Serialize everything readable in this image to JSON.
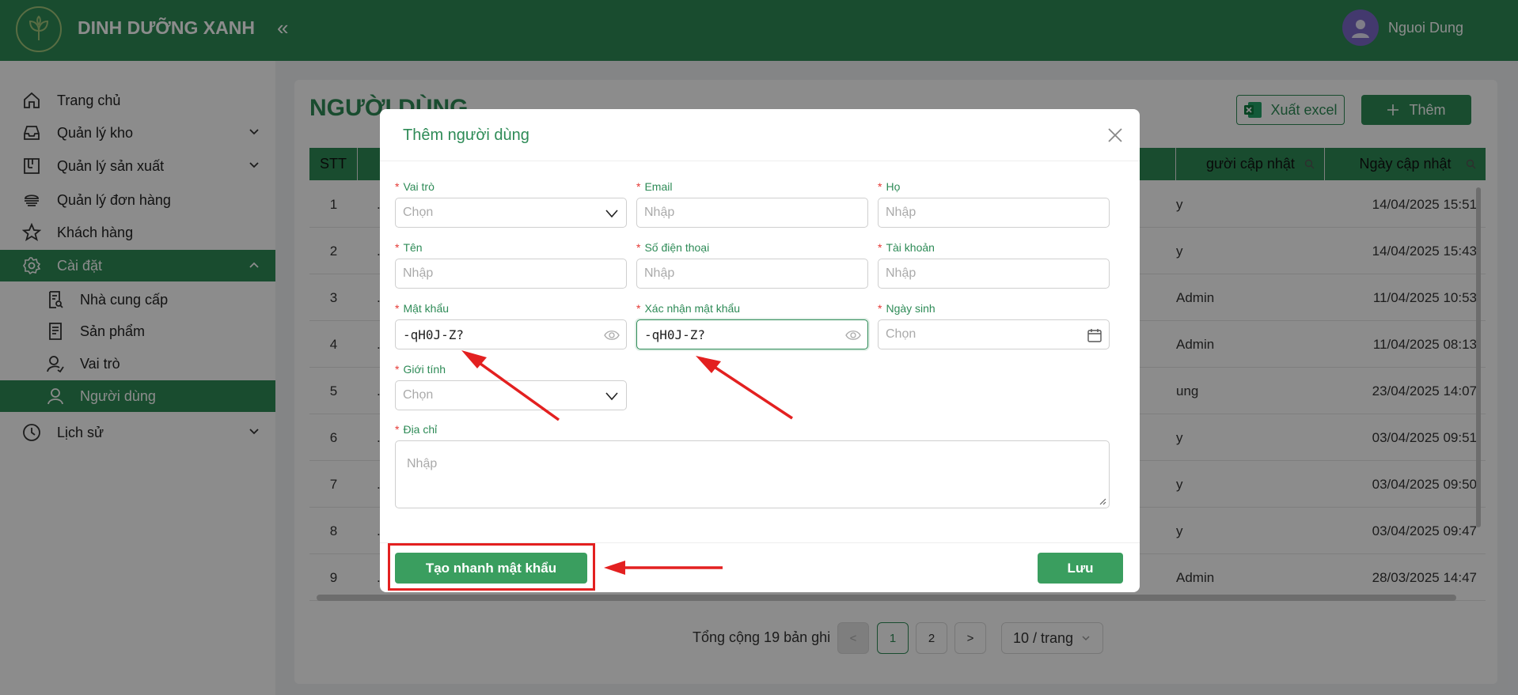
{
  "app": {
    "brand": "DINH DƯỠNG XANH",
    "collapse_glyph": "«",
    "user_name": "Nguoi Dung"
  },
  "sidebar": {
    "items": [
      {
        "label": "Trang chủ",
        "icon": "home-icon"
      },
      {
        "label": "Quản lý kho",
        "icon": "inbox-icon",
        "expandable": true
      },
      {
        "label": "Quản lý sản xuất",
        "icon": "factory-icon",
        "expandable": true
      },
      {
        "label": "Quản lý đơn hàng",
        "icon": "orders-icon"
      },
      {
        "label": "Khách hàng",
        "icon": "star-icon"
      },
      {
        "label": "Cài đặt",
        "icon": "gear-icon",
        "expanded": true,
        "active": true
      },
      {
        "label": "Nhà cung cấp",
        "icon": "supplier-icon"
      },
      {
        "label": "Sản phẩm",
        "icon": "product-icon"
      },
      {
        "label": "Vai trò",
        "icon": "role-icon"
      },
      {
        "label": "Người dùng",
        "icon": "user-icon",
        "active": true
      },
      {
        "label": "Lịch sử",
        "icon": "history-icon",
        "expandable": true
      }
    ]
  },
  "page": {
    "title": "NGƯỜI DÙNG",
    "export_label": "Xuất excel",
    "add_label": "Thêm",
    "table": {
      "headers": [
        "STT",
        "gười cập nhật",
        "Ngày cập nhật"
      ],
      "rows": [
        {
          "stt": "1",
          "updater": "y",
          "date": "14/04/2025 15:51"
        },
        {
          "stt": "2",
          "updater": "y",
          "date": "14/04/2025 15:43"
        },
        {
          "stt": "3",
          "updater": "Admin",
          "date": "11/04/2025 10:53"
        },
        {
          "stt": "4",
          "updater": "Admin",
          "date": "11/04/2025 08:13"
        },
        {
          "stt": "5",
          "updater": "ung",
          "date": "23/04/2025 14:07"
        },
        {
          "stt": "6",
          "updater": "y",
          "date": "03/04/2025 09:51"
        },
        {
          "stt": "7",
          "updater": "y",
          "date": "03/04/2025 09:50"
        },
        {
          "stt": "8",
          "updater": "y",
          "date": "03/04/2025 09:47"
        },
        {
          "stt": "9",
          "updater": "Admin",
          "date": "28/03/2025 14:47"
        }
      ]
    },
    "pagination": {
      "total_text": "Tổng cộng 19 bản ghi",
      "prev": "<",
      "pages": [
        "1",
        "2"
      ],
      "next": ">",
      "page_size": "10 / trang"
    }
  },
  "modal": {
    "title": "Thêm người dùng",
    "fields": {
      "role": {
        "label": "Vai trò",
        "placeholder": "Chọn"
      },
      "email": {
        "label": "Email",
        "placeholder": "Nhập"
      },
      "last_name": {
        "label": "Họ",
        "placeholder": "Nhập"
      },
      "first_name": {
        "label": "Tên",
        "placeholder": "Nhập"
      },
      "phone": {
        "label": "Số điện thoại",
        "placeholder": "Nhập"
      },
      "account": {
        "label": "Tài khoản",
        "placeholder": "Nhập"
      },
      "password": {
        "label": "Mật khẩu",
        "value": "-qH0J-Z?"
      },
      "confirm_password": {
        "label": "Xác nhận mật khẩu",
        "value": "-qH0J-Z?"
      },
      "birthday": {
        "label": "Ngày sinh",
        "placeholder": "Chọn"
      },
      "gender": {
        "label": "Giới tính",
        "placeholder": "Chọn"
      },
      "address": {
        "label": "Địa chỉ",
        "placeholder": "Nhập"
      }
    },
    "required_mark": "*",
    "generate_button": "Tạo nhanh mật khẩu",
    "save_button": "Lưu"
  },
  "colors": {
    "primary": "#2e8b57",
    "highlight": "#e32020"
  }
}
